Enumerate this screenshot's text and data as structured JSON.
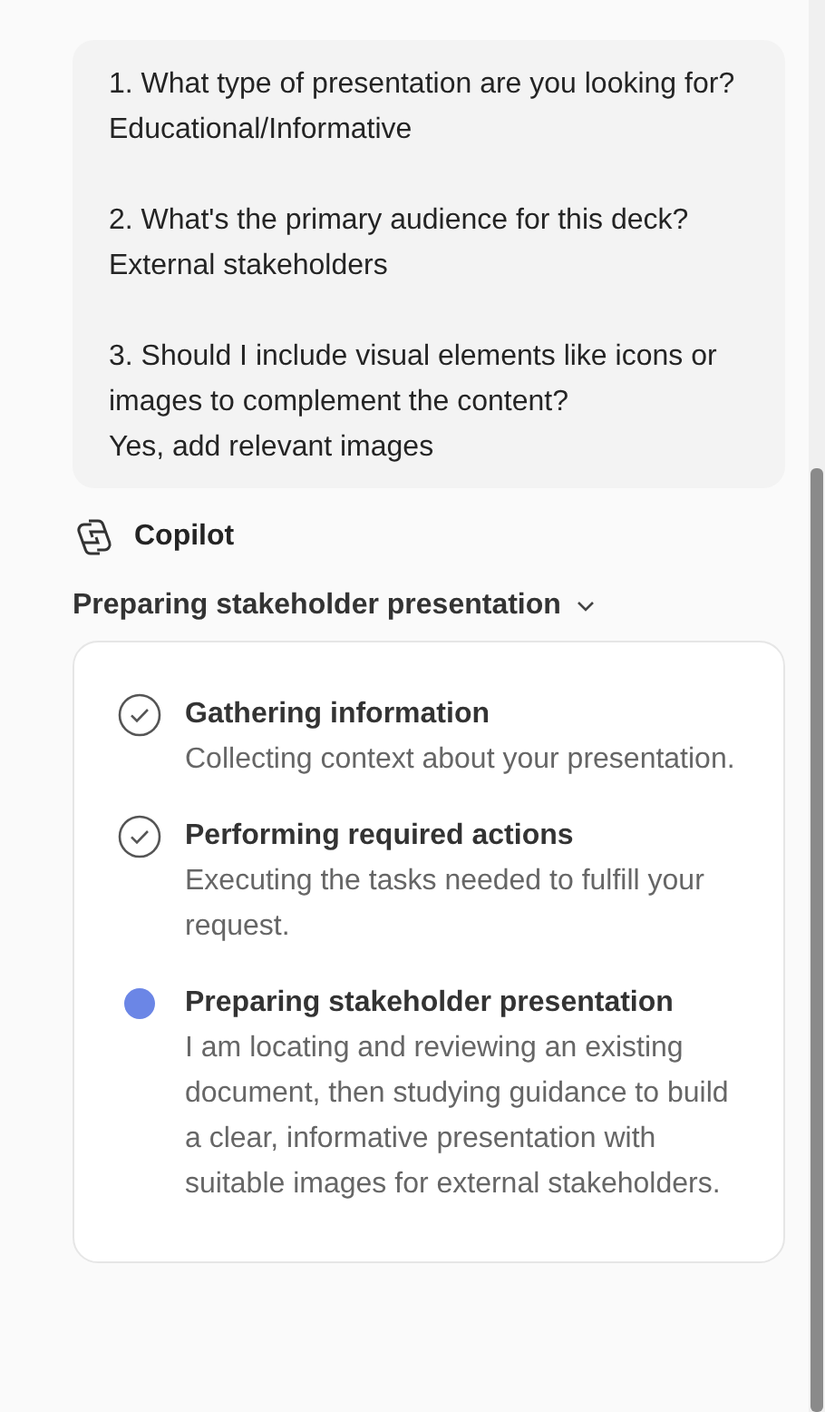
{
  "user_message": {
    "items": [
      {
        "question": "1. What type of presentation are you looking for?",
        "answer": "Educational/Informative"
      },
      {
        "question": "2. What's the primary audience for this deck?",
        "answer": "External stakeholders"
      },
      {
        "question": "3. Should I include visual elements like icons or images to complement the content?",
        "answer": "Yes, add relevant images"
      }
    ]
  },
  "assistant": {
    "name": "Copilot"
  },
  "progress": {
    "title": "Preparing stakeholder presentation",
    "expanded": true,
    "steps": [
      {
        "title": "Gathering information",
        "detail": "Collecting context about your presentation.",
        "done": true
      },
      {
        "title": "Performing required actions",
        "detail": "Executing the tasks needed to fulfill your request.",
        "done": true
      },
      {
        "title": "Preparing stakeholder presentation",
        "detail": "I am locating and reviewing an existing document, then studying guidance to build a clear, informative presentation with suitable images for external stakeholders.",
        "done": false
      }
    ]
  }
}
